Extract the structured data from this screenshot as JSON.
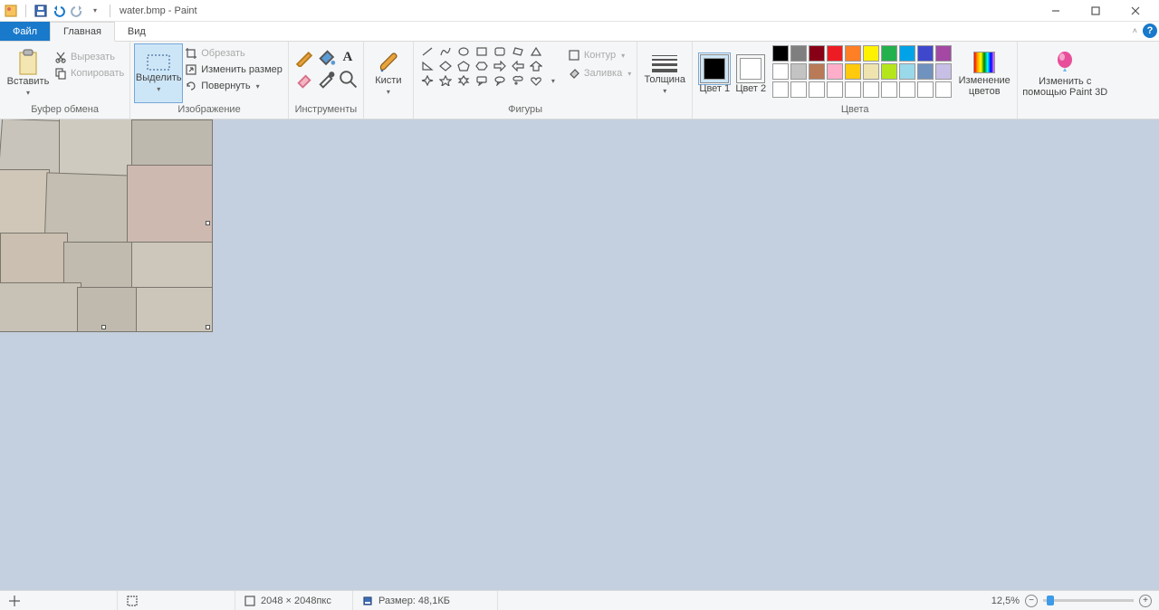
{
  "window": {
    "title": "water.bmp - Paint"
  },
  "tabs": {
    "file": "Файл",
    "home": "Главная",
    "view": "Вид"
  },
  "groups": {
    "clipboard": {
      "label": "Буфер обмена",
      "paste": "Вставить",
      "cut": "Вырезать",
      "copy": "Копировать"
    },
    "image": {
      "label": "Изображение",
      "select": "Выделить",
      "crop": "Обрезать",
      "resize": "Изменить размер",
      "rotate": "Повернуть"
    },
    "tools": {
      "label": "Инструменты"
    },
    "brushes": {
      "label": "Кисти"
    },
    "shapes": {
      "label": "Фигуры",
      "outline": "Контур",
      "fill": "Заливка"
    },
    "size": {
      "label": "Толщина"
    },
    "colors": {
      "label": "Цвета",
      "c1": "Цвет 1",
      "c2": "Цвет 2",
      "edit": "Изменение цветов"
    },
    "paint3d": {
      "label": "Изменить с помощью Paint 3D"
    }
  },
  "palette": {
    "row1": [
      "#000000",
      "#7f7f7f",
      "#880015",
      "#ed1c24",
      "#ff7f27",
      "#fff200",
      "#22b14c",
      "#00a2e8",
      "#3f48cc",
      "#a349a4"
    ],
    "row2": [
      "#ffffff",
      "#c3c3c3",
      "#b97a57",
      "#ffaec9",
      "#ffc90e",
      "#efe4b0",
      "#b5e61d",
      "#99d9ea",
      "#7092be",
      "#c8bfe7"
    ],
    "row3": [
      "#ffffff",
      "#ffffff",
      "#ffffff",
      "#ffffff",
      "#ffffff",
      "#ffffff",
      "#ffffff",
      "#ffffff",
      "#ffffff",
      "#ffffff"
    ]
  },
  "color1": "#000000",
  "color2": "#ffffff",
  "status": {
    "dimensions": "2048 × 2048пкс",
    "filesize": "Размер: 48,1КБ",
    "zoom": "12,5%"
  }
}
